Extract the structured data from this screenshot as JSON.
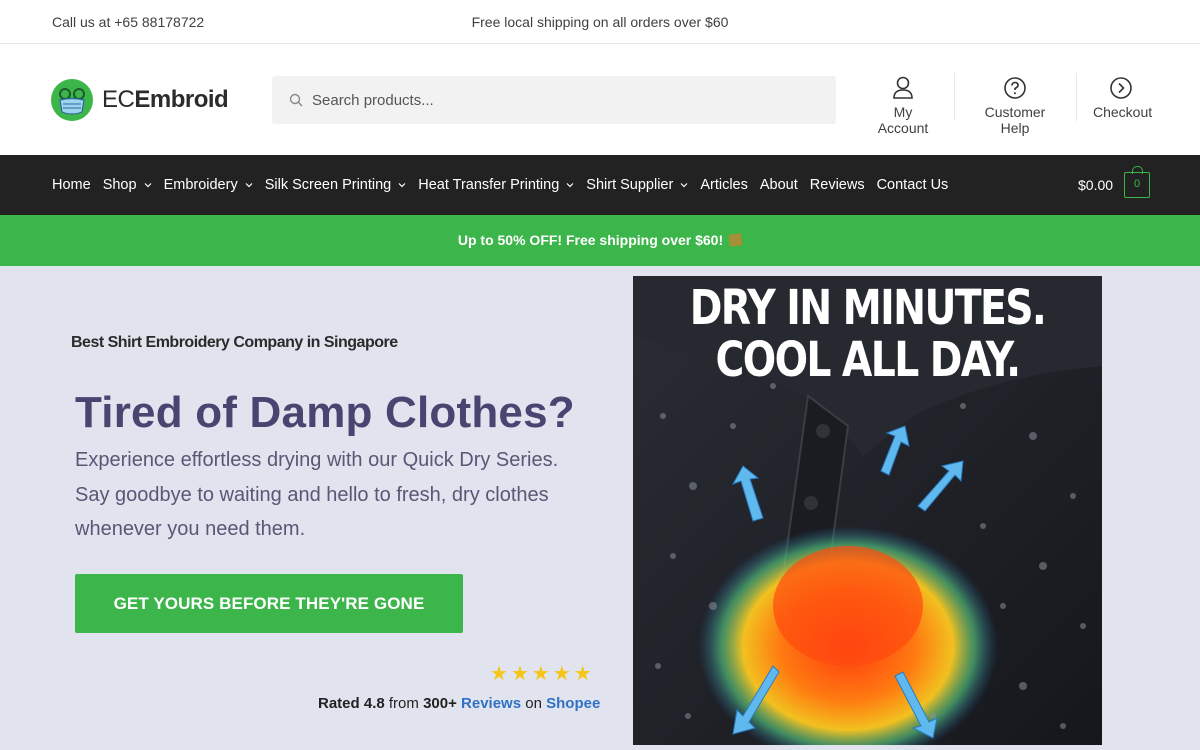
{
  "topbar": {
    "phone": "Call us at +65 88178722",
    "shipping": "Free local shipping on all orders over $60"
  },
  "header": {
    "logo_prefix": "EC",
    "logo_suffix": "Embroid",
    "search_placeholder": "Search products...",
    "links": [
      {
        "label": "My Account",
        "icon": "user-icon"
      },
      {
        "label": "Customer Help",
        "icon": "help-circle-icon"
      },
      {
        "label": "Checkout",
        "icon": "arrow-circle-icon"
      }
    ]
  },
  "nav": {
    "items": [
      {
        "label": "Home",
        "dropdown": false
      },
      {
        "label": "Shop",
        "dropdown": true
      },
      {
        "label": "Embroidery",
        "dropdown": true
      },
      {
        "label": "Silk Screen Printing",
        "dropdown": true
      },
      {
        "label": "Heat Transfer Printing",
        "dropdown": true
      },
      {
        "label": "Shirt Supplier",
        "dropdown": true
      },
      {
        "label": "Articles",
        "dropdown": false
      },
      {
        "label": "About",
        "dropdown": false
      },
      {
        "label": "Reviews",
        "dropdown": false
      },
      {
        "label": "Contact Us",
        "dropdown": false
      }
    ],
    "cart_amount": "$0.00",
    "cart_count": "0"
  },
  "promo": {
    "text": "Up to 50% OFF! Free shipping over $60!"
  },
  "hero": {
    "tagline": "Best Shirt Embroidery Company in Singapore",
    "heading": "Tired of Damp Clothes?",
    "subtext": "Experience effortless drying with our Quick Dry Series. Say goodbye to waiting and hello to fresh, dry clothes whenever you need them.",
    "cta": "GET YOURS BEFORE THEY'RE GONE",
    "rating": {
      "rated_word": "Rated",
      "score": "4.8",
      "from_word": "from",
      "count": "300+",
      "reviews_link": "Reviews",
      "on_word": "on",
      "platform": "Shopee",
      "stars": 5
    },
    "image_title_line1": "DRY IN MINUTES.",
    "image_title_line2": "COOL ALL DAY."
  },
  "colors": {
    "accent_green": "#3cb54a",
    "nav_bg": "#222222",
    "hero_bg": "#e1e4ef",
    "heading_purple": "#4a4470",
    "link_blue": "#2f72c4",
    "star_gold": "#f5c518"
  }
}
